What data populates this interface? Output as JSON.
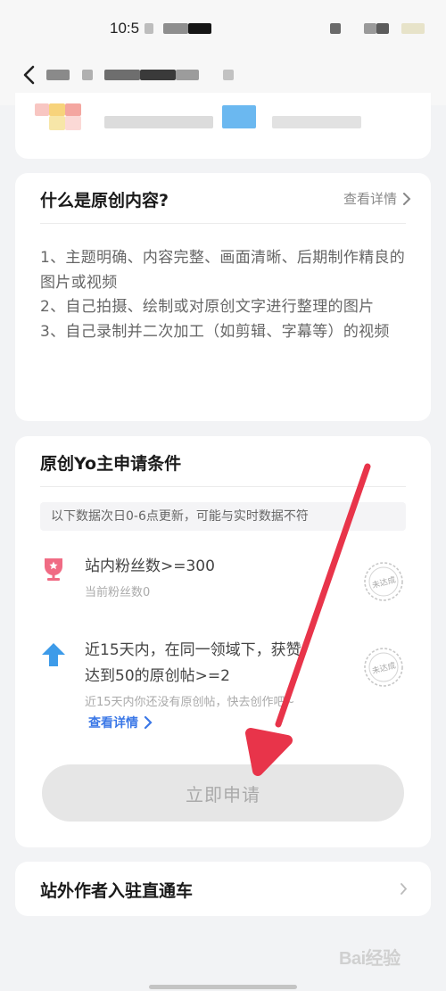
{
  "status": {
    "time": "10:5"
  },
  "what_card": {
    "title": "什么是原创内容?",
    "detail_link": "查看详情",
    "items": [
      "1、主题明确、内容完整、画面清晰、后期制作精良的图片或视频",
      "2、自己拍摄、绘制或对原创文字进行整理的图片",
      "3、自己录制并二次加工（如剪辑、字幕等）的视频"
    ]
  },
  "conditions_card": {
    "title": "原创Yo主申请条件",
    "notice": "以下数据次日0-6点更新，可能与实时数据不符",
    "conditions": [
      {
        "title": "站内粉丝数>=300",
        "subtitle": "当前粉丝数0",
        "status": "未达成"
      },
      {
        "title_line1": "近15天内，在同一领域下，获赞",
        "title_line2": "达到50的原创帖>=2",
        "subtitle": "近15天内你还没有原创帖，快去创作吧~",
        "status": "未达成",
        "detail_link": "查看详情"
      }
    ],
    "apply_button": "立即申请"
  },
  "entry_card": {
    "title": "站外作者入驻直通车"
  },
  "watermark": "Bai经验",
  "colors": {
    "link": "#3b78e7",
    "annotation_arrow": "#e8344a",
    "icon_pink": "#f06b84",
    "icon_blue": "#3d9be9"
  }
}
